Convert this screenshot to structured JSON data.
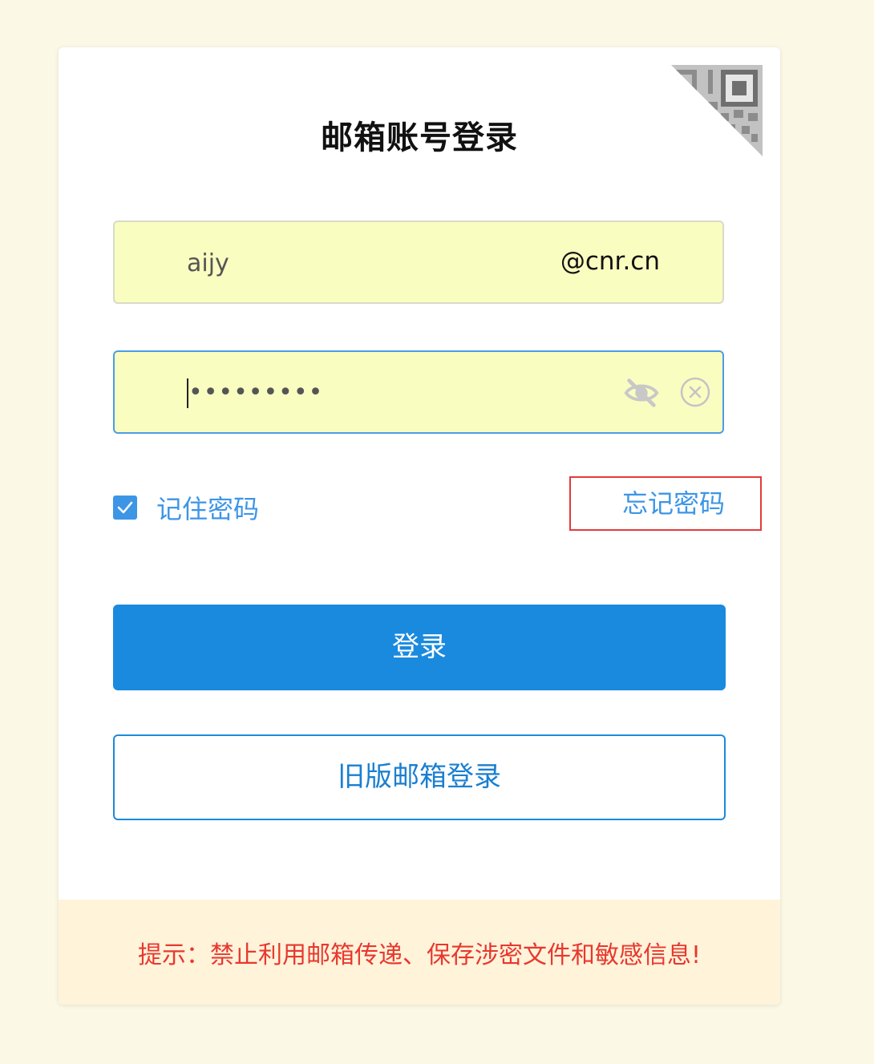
{
  "login": {
    "title": "邮箱账号登录",
    "account_value": "aijy",
    "domain_suffix": "@cnr.cn",
    "password_masked": "•••••••••",
    "remember_label": "记住密码",
    "remember_checked": true,
    "forgot_label": "忘记密码",
    "login_button": "登录",
    "legacy_button": "旧版邮箱登录"
  },
  "notice": {
    "text": "提示：禁止利用邮箱传递、保存涉密文件和敏感信息!"
  },
  "icons": {
    "corner": "qr-code-icon",
    "password_visibility": "eye-off-icon",
    "clear": "clear-circle-icon",
    "checkbox": "check-icon"
  },
  "colors": {
    "page_background": "#fcf8e6",
    "field_background": "#fafdc0",
    "accent": "#1a8ade",
    "link": "#3d95e6",
    "warning": "#e8382f",
    "highlight_border": "#e53a3a"
  }
}
